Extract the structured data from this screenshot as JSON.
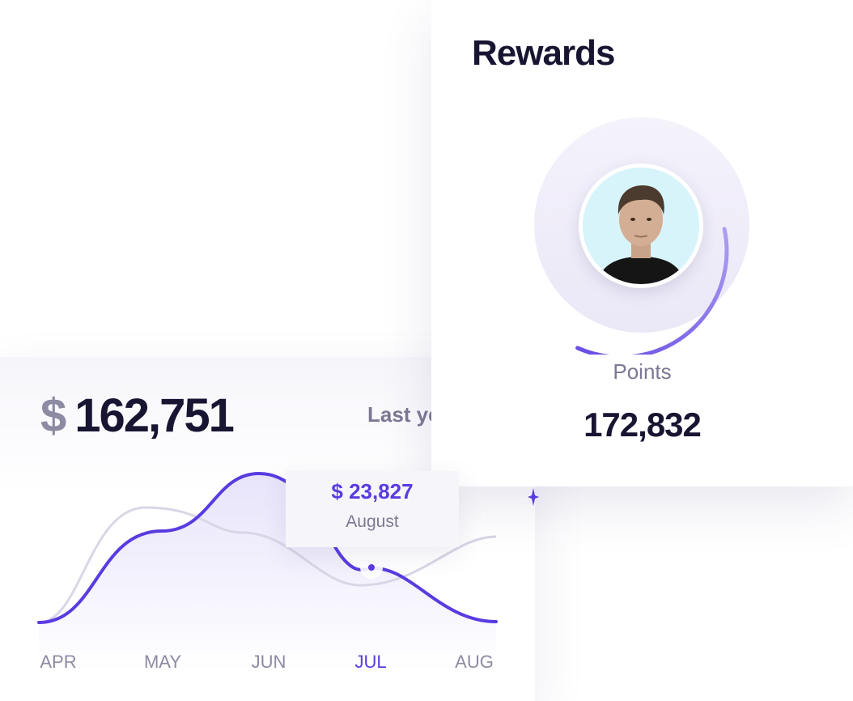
{
  "earnings": {
    "currency_symbol": "$",
    "amount": "162,751",
    "period_label": "Last ye",
    "tooltip": {
      "amount": "$ 23,827",
      "label": "August"
    },
    "months": [
      "APR",
      "MAY",
      "JUN",
      "JUL",
      "AUG"
    ],
    "active_month": "JUL"
  },
  "rewards": {
    "title": "Rewards",
    "points_label": "Points",
    "points_value": "172,832",
    "progress_fraction": 0.35
  },
  "colors": {
    "accent": "#5a3be0",
    "text_dark": "#171531",
    "text_muted": "#7c7894",
    "secondary_line": "#d9d6e6"
  }
}
